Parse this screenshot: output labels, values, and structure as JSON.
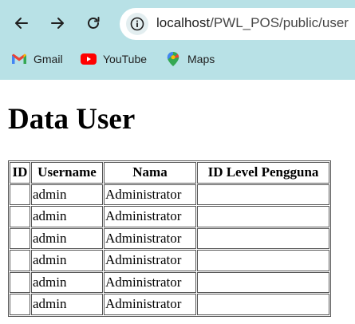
{
  "browser": {
    "url_host": "localhost",
    "url_path": "/PWL_POS/public/user",
    "bookmarks": [
      {
        "label": "Gmail",
        "icon": "gmail-icon"
      },
      {
        "label": "YouTube",
        "icon": "youtube-icon"
      },
      {
        "label": "Maps",
        "icon": "maps-icon"
      }
    ],
    "chrome_color": "#b8e1e6"
  },
  "page": {
    "title": "Data User",
    "table": {
      "headers": [
        "ID",
        "Username",
        "Nama",
        "ID Level Pengguna"
      ],
      "rows": [
        [
          "",
          "admin",
          "Administrator",
          ""
        ],
        [
          "",
          "admin",
          "Administrator",
          ""
        ],
        [
          "",
          "admin",
          "Administrator",
          ""
        ],
        [
          "",
          "admin",
          "Administrator",
          ""
        ],
        [
          "",
          "admin",
          "Administrator",
          ""
        ],
        [
          "",
          "admin",
          "Administrator",
          ""
        ]
      ]
    }
  }
}
